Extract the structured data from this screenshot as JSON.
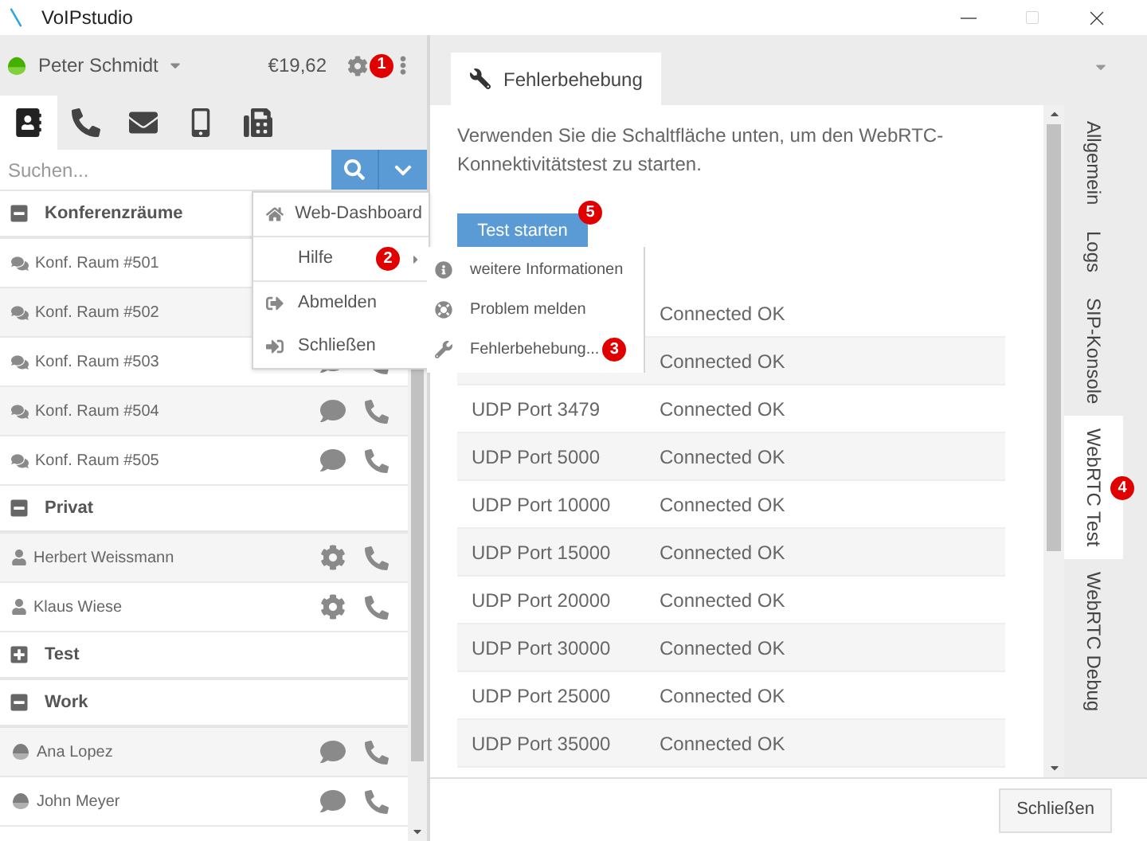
{
  "window": {
    "title": "VoIPstudio"
  },
  "account": {
    "name": "Peter Schmidt",
    "balance": "€19,62",
    "badge": "1"
  },
  "nav_tabs": [
    {
      "kind": "contacts",
      "selected": true
    },
    {
      "kind": "calls",
      "selected": false
    },
    {
      "kind": "messages",
      "selected": false
    },
    {
      "kind": "mobile",
      "selected": false
    },
    {
      "kind": "fax",
      "selected": false
    }
  ],
  "search": {
    "placeholder": "Suchen..."
  },
  "contact_groups": [
    {
      "name": "Konferenzräume",
      "expanded": true,
      "contacts": [
        {
          "kind": "room",
          "name": "Konf. Raum #501",
          "covered_by_menu": true
        },
        {
          "kind": "room",
          "name": "Konf. Raum #502",
          "covered_by_menu": true
        },
        {
          "kind": "room",
          "name": "Konf. Raum #503"
        },
        {
          "kind": "room",
          "name": "Konf. Raum #504"
        },
        {
          "kind": "room",
          "name": "Konf. Raum #505"
        }
      ]
    },
    {
      "name": "Privat",
      "expanded": true,
      "contacts": [
        {
          "kind": "user",
          "name": "Herbert Weissmann"
        },
        {
          "kind": "user",
          "name": "Klaus Wiese"
        }
      ]
    },
    {
      "name": "Test",
      "expanded": false
    },
    {
      "name": "Work",
      "expanded": true,
      "contacts": [
        {
          "kind": "presence",
          "name": "Ana Lopez"
        },
        {
          "kind": "presence",
          "name": "John Meyer"
        }
      ]
    }
  ],
  "menu": {
    "sections": [
      [
        {
          "kind": "home",
          "label": "Web-Dashboard"
        }
      ],
      [
        {
          "kind": "submenu",
          "label": "Hilfe",
          "badge": "2"
        }
      ],
      [
        {
          "kind": "logout",
          "label": "Abmelden"
        },
        {
          "kind": "exit",
          "label": "Schließen"
        }
      ]
    ]
  },
  "submenu": {
    "items": [
      {
        "kind": "info",
        "label": "weitere Informationen"
      },
      {
        "kind": "lifebuoy",
        "label": "Problem melden"
      },
      {
        "kind": "wrench",
        "label": "Fehlerbehebung...",
        "badge": "3"
      }
    ]
  },
  "panel": {
    "tab": {
      "label": "Fehlerbehebung"
    },
    "description": "Verwenden Sie die Schaltfläche unten, um den WebRTC-Konnektivitätstest zu starten.",
    "start_button": {
      "label": "Test starten",
      "badge": "5"
    },
    "results": [
      {
        "status": "Connected OK"
      },
      {
        "status": "Connected OK"
      },
      {
        "port": "UDP Port 3479",
        "status": "Connected OK"
      },
      {
        "port": "UDP Port 5000",
        "status": "Connected OK"
      },
      {
        "port": "UDP Port 10000",
        "status": "Connected OK"
      },
      {
        "port": "UDP Port 15000",
        "status": "Connected OK"
      },
      {
        "port": "UDP Port 20000",
        "status": "Connected OK"
      },
      {
        "port": "UDP Port 30000",
        "status": "Connected OK"
      },
      {
        "port": "UDP Port 25000",
        "status": "Connected OK"
      },
      {
        "port": "UDP Port 35000",
        "status": "Connected OK"
      }
    ]
  },
  "side_tabs": [
    {
      "label": "Allgemein",
      "selected": false
    },
    {
      "label": "Logs",
      "selected": false
    },
    {
      "label": "SIP-Konsole",
      "selected": false
    },
    {
      "label": "WebRTC Test",
      "selected": true,
      "badge": "4"
    },
    {
      "label": "WebRTC Debug",
      "selected": false
    }
  ],
  "footer": {
    "close_button": "Schließen"
  }
}
